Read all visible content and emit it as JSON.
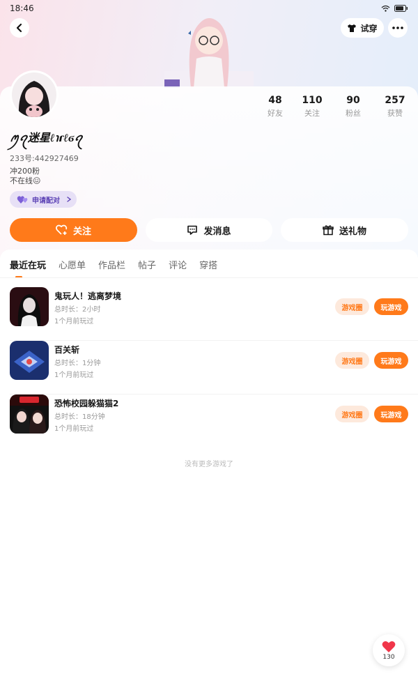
{
  "status_bar": {
    "time": "18:46"
  },
  "header": {
    "try_on_label": "试穿"
  },
  "profile": {
    "nickname": "ꪑꪖ迷星ℓ℩ɾℓϭꪖ",
    "uid": "233号:442927469",
    "bio_line1": "冲200粉",
    "bio_line2": "不在线😖",
    "pair_label": "申请配对",
    "stats": [
      {
        "value": "48",
        "label": "好友"
      },
      {
        "value": "110",
        "label": "关注"
      },
      {
        "value": "90",
        "label": "粉丝"
      },
      {
        "value": "257",
        "label": "获赞"
      }
    ]
  },
  "actions": {
    "follow": "关注",
    "message": "发消息",
    "gift": "送礼物"
  },
  "tabs": [
    "最近在玩",
    "心愿单",
    "作品栏",
    "帖子",
    "评论",
    "穿搭"
  ],
  "games": [
    {
      "name": "鬼玩人！逃离梦境",
      "duration": "总时长：2小时",
      "last_played": "1个月前玩过",
      "circle": "游戏圈",
      "play": "玩游戏"
    },
    {
      "name": "百关斩",
      "duration": "总时长：1分钟",
      "last_played": "1个月前玩过",
      "circle": "游戏圈",
      "play": "玩游戏"
    },
    {
      "name": "恐怖校园躲猫猫2",
      "duration": "总时长：18分钟",
      "last_played": "1个月前玩过",
      "circle": "游戏圈",
      "play": "玩游戏"
    }
  ],
  "no_more_text": "没有更多游戏了",
  "like_count": "130",
  "colors": {
    "accent": "#ff7a1a",
    "pair_bg": "#e7e0f6",
    "pair_text": "#5a3fb4"
  }
}
